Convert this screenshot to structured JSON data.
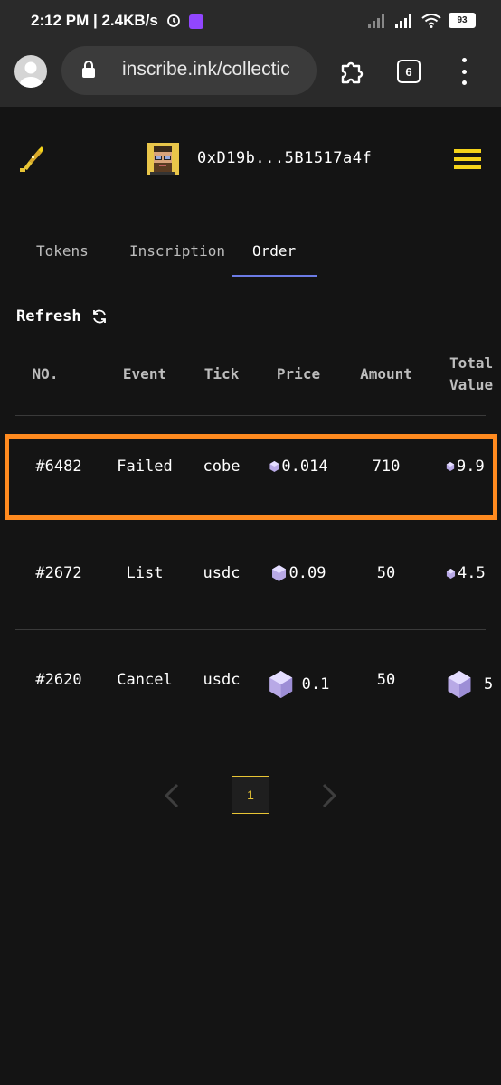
{
  "status_bar": {
    "time": "2:12 PM",
    "net_speed": "| 2.4KB/s",
    "battery": "93",
    "icons": [
      "alarm-icon",
      "twitch-icon",
      "signal-icon",
      "wifi-icon",
      "battery-icon"
    ]
  },
  "browser": {
    "url": "inscribe.ink/collectic",
    "tab_count": "6",
    "icons": [
      "profile-icon",
      "lock-icon",
      "extensions-icon",
      "tabs-icon",
      "more-icon"
    ]
  },
  "header": {
    "wallet": "0xD19b...5B1517a4f",
    "accent_color": "#f4d31a",
    "icons": [
      "pen-logo-icon",
      "user-avatar",
      "hamburger-icon"
    ]
  },
  "tabs": [
    {
      "label": "Tokens",
      "active": false
    },
    {
      "label": "Inscription",
      "active": false
    },
    {
      "label": "Order",
      "active": true
    }
  ],
  "refresh_label": "Refresh",
  "table": {
    "headers": [
      "NO.",
      "Event",
      "Tick",
      "Price",
      "Amount"
    ],
    "total_header_line1": "Total",
    "total_header_line2": "Value",
    "rows": [
      {
        "no": "#6482",
        "event": "Failed",
        "tick": "cobe",
        "price": "0.014",
        "amount": "710",
        "total": "9.9"
      },
      {
        "no": "#2672",
        "event": "List",
        "tick": "usdc",
        "price": "0.09",
        "amount": "50",
        "total": "4.5"
      },
      {
        "no": "#2620",
        "event": "Cancel",
        "tick": "usdc",
        "price": "0.1",
        "amount": "50",
        "total": "5"
      }
    ],
    "highlight_color": "#ff8a1f"
  },
  "pagination": {
    "current_page": "1"
  }
}
